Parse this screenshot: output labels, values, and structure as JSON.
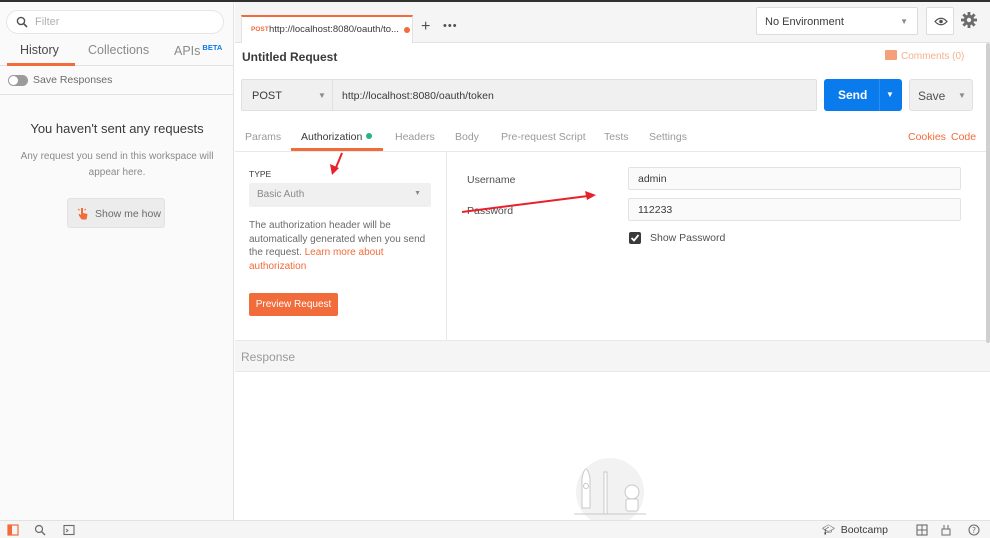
{
  "sidebar": {
    "filter_placeholder": "Filter",
    "tabs": [
      {
        "label": "History"
      },
      {
        "label": "Collections"
      },
      {
        "label": "APIs",
        "badge": "BETA"
      }
    ],
    "save_responses_label": "Save Responses",
    "empty_title": "You haven't sent any requests",
    "empty_desc": "Any request you send in this workspace will appear here.",
    "show_me_label": "Show me how"
  },
  "header": {
    "tab": {
      "method": "POST",
      "url": "http://localhost:8080/oauth/to..."
    },
    "environment": "No Environment"
  },
  "request": {
    "name": "Untitled Request",
    "comments": "Comments (0)",
    "method": "POST",
    "url": "http://localhost:8080/oauth/token",
    "send_label": "Send",
    "save_label": "Save",
    "tabs": [
      "Params",
      "Authorization",
      "Headers",
      "Body",
      "Pre-request Script",
      "Tests",
      "Settings"
    ],
    "links": [
      "Cookies",
      "Code"
    ]
  },
  "auth": {
    "type_label": "TYPE",
    "type_value": "Basic Auth",
    "desc": "The authorization header will be automatically generated when you send the request.",
    "learn_more": "Learn more about authorization",
    "preview_label": "Preview Request",
    "username_label": "Username",
    "username_value": "admin",
    "password_label": "Password",
    "password_value": "112233",
    "show_password_label": "Show Password",
    "show_password_checked": true
  },
  "response": {
    "label": "Response"
  },
  "footer": {
    "bootcamp_label": "Bootcamp"
  },
  "colors": {
    "accent": "#f26b3a",
    "primary": "#097bed",
    "active_dot": "#26b47f",
    "annotation": "#e8202a"
  }
}
